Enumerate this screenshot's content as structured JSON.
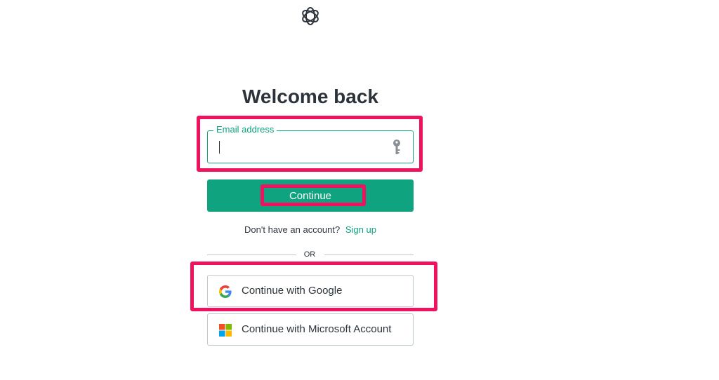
{
  "header": {
    "logo_icon": "openai-logo-icon"
  },
  "main": {
    "title": "Welcome back",
    "email": {
      "label": "Email address",
      "value": "",
      "icon": "key-icon"
    },
    "continue_label": "Continue",
    "signup": {
      "prompt": "Don't have an account?",
      "link": "Sign up"
    },
    "divider": "OR",
    "social": [
      {
        "label": "Continue with Google",
        "icon": "google-icon"
      },
      {
        "label": "Continue with Microsoft Account",
        "icon": "microsoft-icon"
      }
    ]
  },
  "colors": {
    "accent": "#10a37f",
    "highlight": "#f0125f",
    "text": "#2d333a",
    "border": "#c2c8d0"
  }
}
